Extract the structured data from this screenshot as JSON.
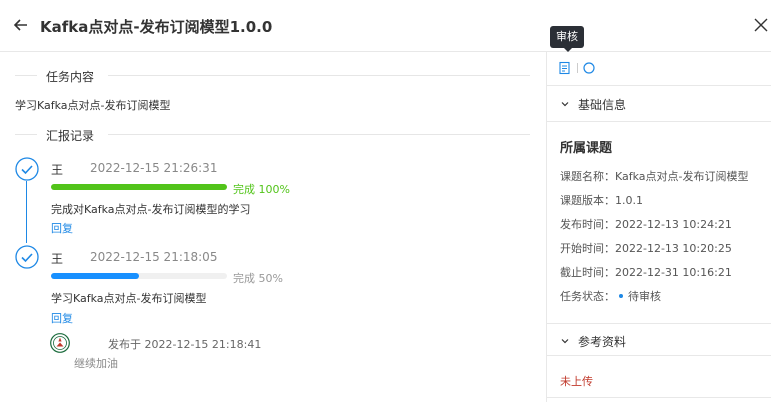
{
  "header": {
    "title": "Kafka点对点-发布订阅模型1.0.0",
    "tooltip": "审核"
  },
  "task": {
    "section_title": "任务内容",
    "content": "学习Kafka点对点-发布订阅模型"
  },
  "reports": {
    "section_title": "汇报记录",
    "items": [
      {
        "user": "王",
        "time": "2022-12-15 21:26:31",
        "progress": 100,
        "status_label": "完成 100%",
        "color": "#52c41a",
        "desc": "完成对Kafka点对点-发布订阅模型的学习",
        "reply": "回复"
      },
      {
        "user": "王",
        "time": "2022-12-15 21:18:05",
        "progress": 50,
        "status_label": "完成 50%",
        "color": "#1890ff",
        "desc": "学习Kafka点对点-发布订阅模型",
        "reply": "回复"
      }
    ],
    "comment": {
      "time_text": "发布于 2022-12-15 21:18:41",
      "text": "继续加油"
    }
  },
  "panel": {
    "basic_info": {
      "heading": "基础信息",
      "subheading": "所属课题",
      "rows": [
        {
          "label": "课题名称：",
          "value": "Kafka点对点-发布订阅模型"
        },
        {
          "label": "课题版本：",
          "value": "1.0.1"
        },
        {
          "label": "发布时间：",
          "value": "2022-12-13 10:24:21"
        },
        {
          "label": "开始时间：",
          "value": "2022-12-13 10:20:25"
        },
        {
          "label": "截止时间：",
          "value": "2022-12-31 10:16:21"
        },
        {
          "label": "任务状态：",
          "value": "待审核"
        }
      ]
    },
    "references": {
      "heading": "参考资料",
      "empty_text": "未上传"
    }
  },
  "icons": [
    "back-arrow-icon",
    "close-icon",
    "review-doc-icon",
    "comment-bubble-icon",
    "check-circle-icon",
    "chevron-down-icon",
    "avatar-emblem"
  ]
}
